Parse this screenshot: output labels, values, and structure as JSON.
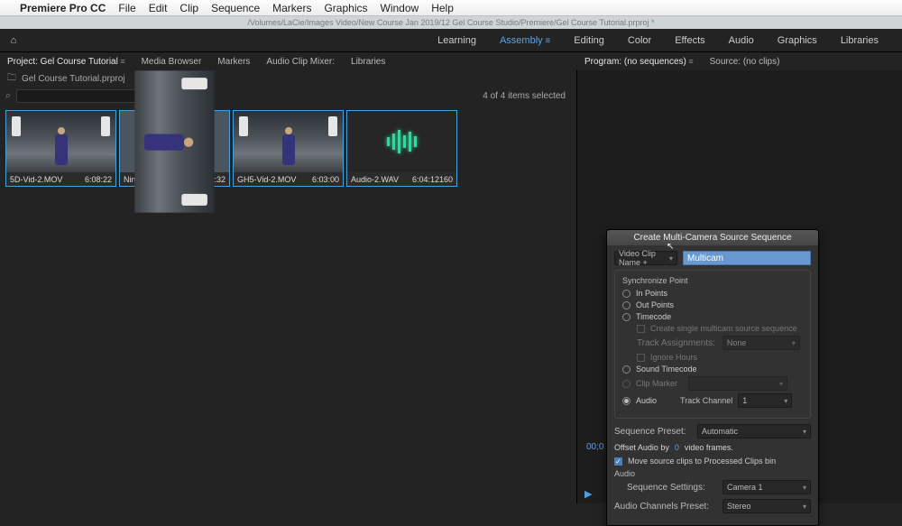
{
  "menubar": {
    "app": "Premiere Pro CC",
    "items": [
      "File",
      "Edit",
      "Clip",
      "Sequence",
      "Markers",
      "Graphics",
      "Window",
      "Help"
    ]
  },
  "titlebar": {
    "path": "/Volumes/LaCie/Images Video/New Course Jan 2019/12 Gel Course Studio/Premiere/Gel Course Tutorial.prproj *"
  },
  "home_icon": "⌂",
  "workspaces": {
    "items": [
      "Learning",
      "Assembly",
      "Editing",
      "Color",
      "Effects",
      "Audio",
      "Graphics",
      "Libraries"
    ],
    "active": "Assembly"
  },
  "left_tabs": {
    "items": [
      "Project: Gel Course Tutorial",
      "Media Browser",
      "Markers",
      "Audio Clip Mixer:",
      "Libraries"
    ],
    "active": "Project: Gel Course Tutorial"
  },
  "right_tabs": {
    "items": [
      "Program: (no sequences)",
      "Source: (no clips)"
    ],
    "active": "Program: (no sequences)"
  },
  "project": {
    "filename": "Gel Course Tutorial.prproj",
    "search_placeholder": "",
    "selection": "4 of 4 items selected"
  },
  "clips": [
    {
      "name": "5D-Vid-2.MOV",
      "dur": "6:08:22",
      "kind": "video"
    },
    {
      "name": "Ninja-Vid-2.MOV",
      "dur": "6:01:32",
      "kind": "video"
    },
    {
      "name": "GH5-Vid-2.MOV",
      "dur": "6:03:00",
      "kind": "video"
    },
    {
      "name": "Audio-2.WAV",
      "dur": "6:04:12160",
      "kind": "audio"
    }
  ],
  "dialog": {
    "title": "Create Multi-Camera Source Sequence",
    "name_mode": "Video Clip Name +",
    "name_value": "Multicam",
    "sync_legend": "Synchronize Point",
    "sync": {
      "in": "In Points",
      "out": "Out Points",
      "tc": "Timecode",
      "tc_sub_create": "Create single multicam source sequence",
      "tc_track": "Track Assignments:",
      "tc_track_val": "None",
      "tc_ignore": "Ignore Hours",
      "sound": "Sound Timecode",
      "marker": "Clip Marker",
      "audio": "Audio",
      "track_ch": "Track Channel",
      "track_ch_val": "1",
      "selected": "audio"
    },
    "seq_preset_lbl": "Sequence Preset:",
    "seq_preset": "Automatic",
    "offset": {
      "pre": "Offset Audio by",
      "val": "0",
      "post": "video frames."
    },
    "move_clips": "Move source clips to Processed Clips bin",
    "audio_section": "Audio",
    "seq_set_lbl": "Sequence Settings:",
    "seq_set": "Camera 1",
    "ch_preset_lbl": "Audio Channels Preset:",
    "ch_preset": "Stereo"
  },
  "timecode": "00;0",
  "play_glyph": "▶"
}
